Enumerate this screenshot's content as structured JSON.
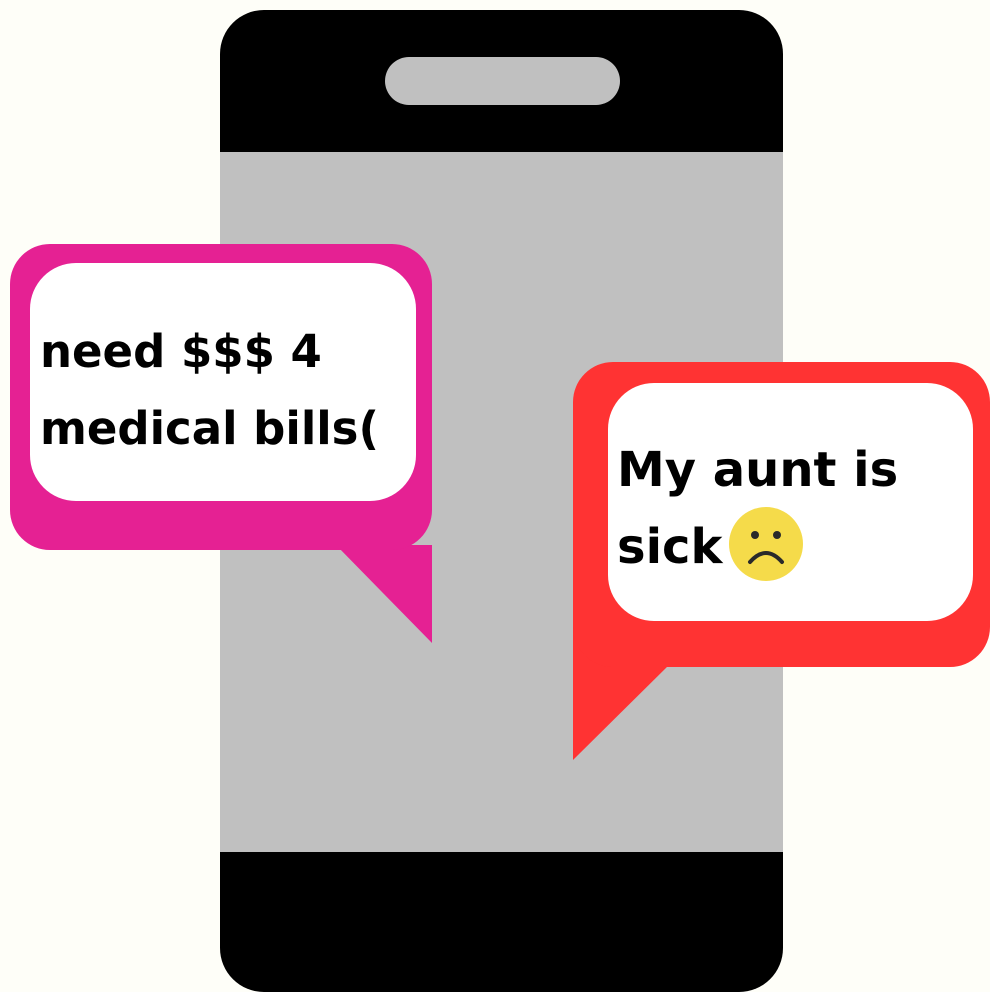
{
  "colors": {
    "background": "#fefef8",
    "phone_body": "#000000",
    "phone_screen": "#c0c0c0",
    "phone_speaker": "#c0c0c0",
    "left_bubble": "#e52193",
    "right_bubble": "#ff3333",
    "bubble_inner": "#ffffff",
    "emoji_face": "#f5db4a"
  },
  "messages": {
    "left": {
      "line1": "need $$$ 4",
      "line2": "medical bills("
    },
    "right": {
      "line1": "My aunt is",
      "line2": "sick",
      "emoji": "sad-face-icon"
    }
  }
}
